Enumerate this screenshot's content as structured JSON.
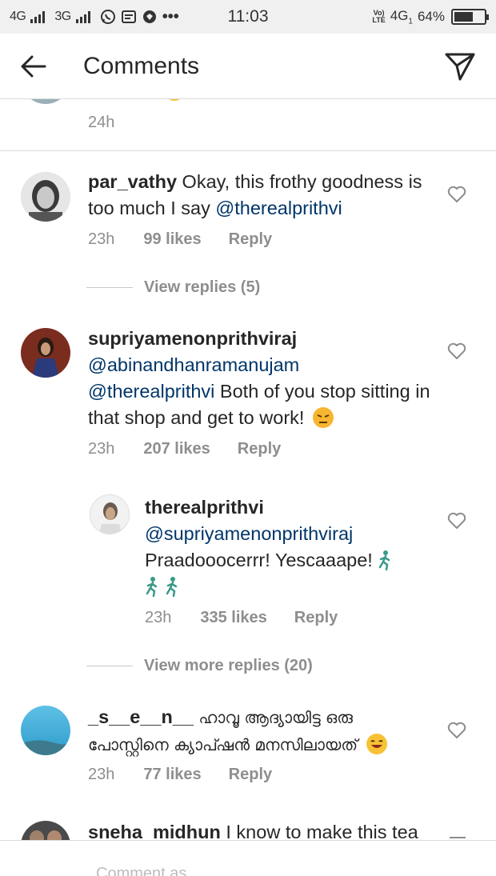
{
  "status_bar": {
    "net1": "4G",
    "net2": "3G",
    "time": "11:03",
    "volte": "Vo)\nLTE",
    "net3": "4G",
    "net3_sub": "1",
    "battery": "64%",
    "battery_level": 0.64
  },
  "header": {
    "title": "Comments"
  },
  "top_partial": {
    "time": "24h"
  },
  "comments": [
    {
      "username": "par_vathy",
      "text_before": " Okay, this frothy goodness is too much I say ",
      "mention": "@therealprithvi",
      "time": "23h",
      "likes": "99 likes",
      "reply": "Reply",
      "view_replies": "View replies (5)"
    },
    {
      "username": "supriyamenonprithviraj",
      "mention1": "@abinandhanramanujam",
      "mention2": "@therealprithvi",
      "text_after": " Both of you stop sitting in that shop and get to work! ",
      "time": "23h",
      "likes": "207 likes",
      "reply": "Reply"
    },
    {
      "username": "therealprithvi",
      "mention": "@supriyamenonprithviraj",
      "text": "Praadooocerrr! Yescaaape! ",
      "time": "23h",
      "likes": "335 likes",
      "reply": "Reply",
      "view_more": "View more replies (20)"
    },
    {
      "username": "_s__e__n__",
      "text": " ഹാവൂ ആദ്യായിട്ട ഒരു പോസ്റ്റിനെ ക്യാപ്ഷൻ മനസിലായത് ",
      "time": "23h",
      "likes": "77 likes",
      "reply": "Reply"
    },
    {
      "username": "sneha_midhun",
      "text": " I know to make this tea"
    }
  ],
  "bottom": {
    "placeholder": "Comment as ..."
  },
  "colors": {
    "mention": "#003569",
    "meta": "#8e8e8e",
    "text": "#262626"
  }
}
